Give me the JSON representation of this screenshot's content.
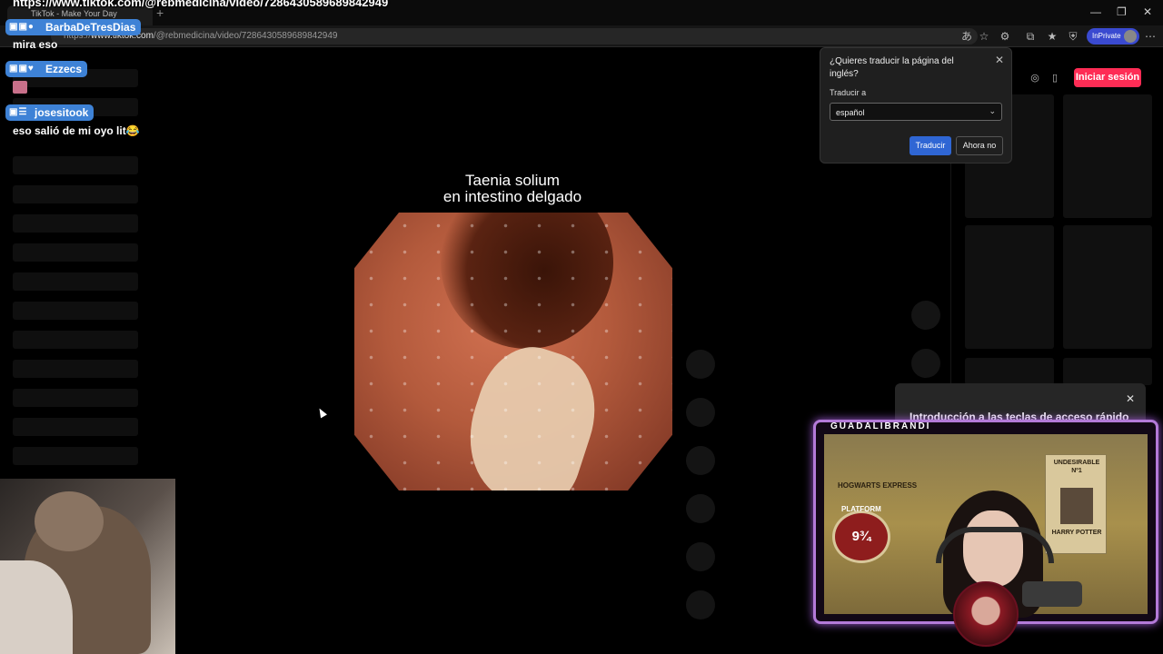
{
  "browser": {
    "tab_title": "TikTok - Make Your Day",
    "overlay_url": "https://www.tiktok.com/@rebmedicina/video/7286430589689842949",
    "address_prefix": "https://",
    "address_host": "www.tiktok.com",
    "address_path": "/@rebmedicina/video/7286430589689842949",
    "inprivate_label": "InPrivate",
    "window_controls": [
      "—",
      "❐",
      "✕"
    ]
  },
  "chat": [
    {
      "user": "BarbaDeTresDias",
      "message": "mira eso"
    },
    {
      "user": "Ezzecs",
      "message": ""
    },
    {
      "user": "josesitook",
      "message": "eso salió de mi oyo lit😂"
    }
  ],
  "video": {
    "title_line1": "Taenia solium",
    "title_line2": "en intestino delgado"
  },
  "header": {
    "login_label": "Iniciar sesión"
  },
  "translate_popup": {
    "question": "¿Quieres traducir la página del inglés?",
    "translate_to_label": "Traducir a",
    "language_value": "español",
    "translate_button": "Traducir",
    "dismiss_button": "Ahora no"
  },
  "toast": {
    "text": "Introducción a las teclas de acceso rápido"
  },
  "streamer": {
    "name": "GUADALIBRANDI",
    "posters": {
      "hogwarts": "HOGWARTS EXPRESS",
      "platform": "PLATFORM",
      "platform_number": "9¾",
      "wanted_title": "UNDESIRABLE",
      "wanted_number": "Nº1",
      "wanted_name": "HARRY POTTER"
    }
  },
  "colors": {
    "tiktok_red": "#fe2c55",
    "chat_badge_blue": "#3e82d6",
    "translate_blue": "#2f66d4",
    "cam_border_purple": "#b37ad8"
  }
}
